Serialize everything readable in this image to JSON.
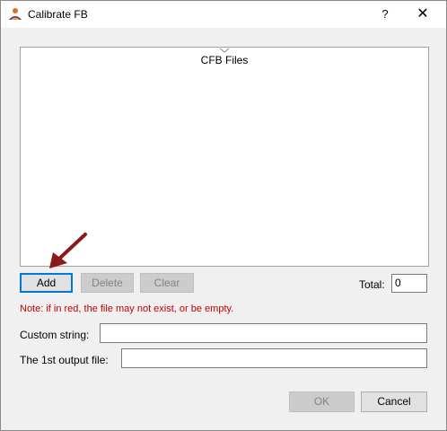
{
  "window": {
    "title": "Calibrate FB",
    "help_label": "?",
    "close_label": "✕"
  },
  "file_list": {
    "header": "CFB Files",
    "items": []
  },
  "buttons": {
    "add": "Add",
    "delete": "Delete",
    "clear": "Clear",
    "ok": "OK",
    "cancel": "Cancel"
  },
  "total": {
    "label": "Total:",
    "value": "0"
  },
  "note": "Note: if in red, the file may not exist, or be empty.",
  "custom_string": {
    "label": "Custom string:",
    "value": ""
  },
  "output_file": {
    "label": "The 1st output file:",
    "value": ""
  },
  "icons": {
    "app": "person-icon",
    "annotation": "red-arrow-icon"
  },
  "colors": {
    "note": "#c00000",
    "focus": "#0078d7",
    "arrow": "#8b1a1a"
  }
}
